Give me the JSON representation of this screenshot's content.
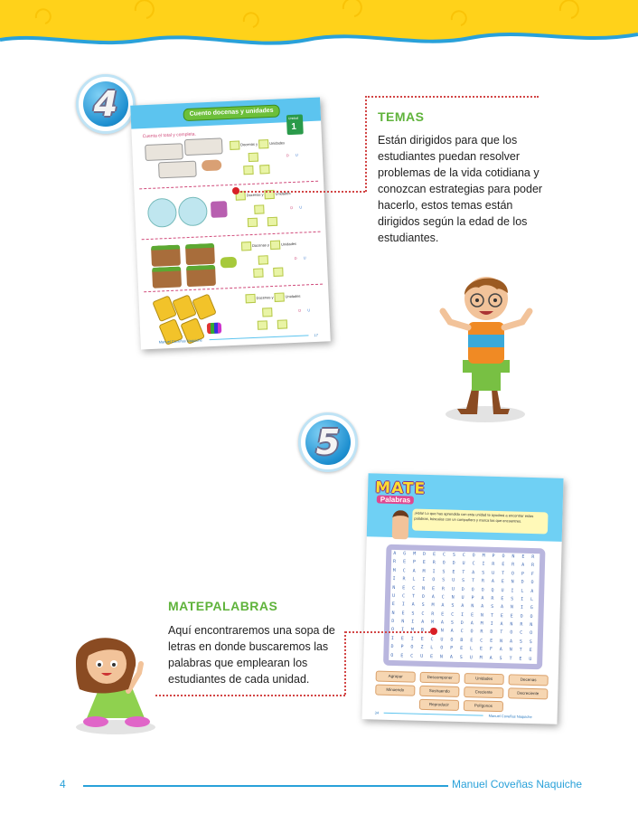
{
  "section4": {
    "number": "4",
    "heading": "TEMAS",
    "body": "Están dirigidos para que los estudiantes puedan resolver problemas de la vida cotidiana y conozcan estrategias para poder hacerlo, estos temas están dirigidos según la edad de los estudiantes.",
    "sheet": {
      "title": "Cuento docenas y unidades",
      "instruction": "Cuenta el total y completa.",
      "tab_label": "Unidad",
      "tab_number": "1",
      "row_label_a": "Docenas y",
      "row_label_b": "Unidades",
      "col_d": "D",
      "col_u": "U",
      "footer_left": "Manuel Coveñas Naquiche",
      "page_number": "17"
    }
  },
  "section5": {
    "number": "5",
    "heading": "MATEPALABRAS",
    "body": "Aquí encontraremos una sopa de letras en donde buscaremos las palabras que emplearan los estudiantes de cada unidad.",
    "sheet": {
      "logo_top": "MATE",
      "logo_bottom": "Palabras",
      "bubble": "¡Hola! Lo que has aprendido con esta unidad te ayudará a encontrar estas palabras, búscalas con un compañero y marca las que encuentres.",
      "grid_rows": [
        "AGMDECSCOMPONER",
        "REPERODUCIRERAR",
        "MCAMISETASUTOPF",
        "IRLIOSUSTRAENDO",
        "NECNERUDOOQUILA",
        "UCTOACNUPARESIL",
        "EIASMASANASANIG",
        "NESCRECIENTEEOO",
        "DNIAMASDAMIANRN",
        "OIMBENACORDTOCO",
        "IEIECUOBECENASS",
        "DPOZLOPELEFANTE",
        "OECUENASUMASTEU"
      ],
      "words": [
        "Agrupar",
        "Descomponer",
        "Unidades",
        "Decenas",
        "Minuendo",
        "Sustraendo",
        "Creciente",
        "Decreciente",
        "Reproducir",
        "Polígonos"
      ],
      "footer_left": "34",
      "footer_right": "Manuel Coveñas Naquiche"
    }
  },
  "footer": {
    "page_number": "4",
    "author": "Manuel Coveñas Naquiche"
  },
  "colors": {
    "heading_green": "#5fb33b",
    "accent_blue": "#29a1d9",
    "banner_yellow": "#ffd21a",
    "dotted_red": "#d24545"
  }
}
